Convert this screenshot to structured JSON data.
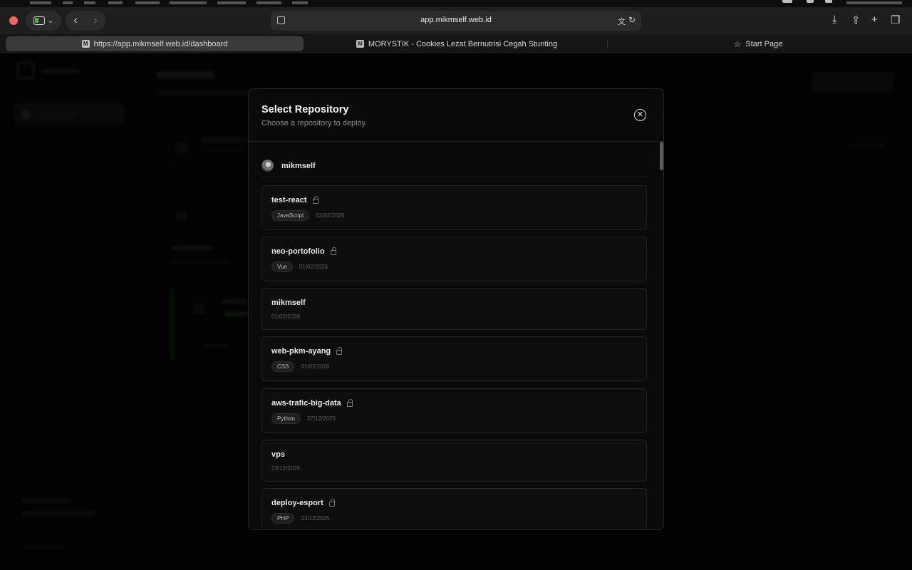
{
  "browser": {
    "address": "app.mikmself.web.id",
    "tabs": [
      {
        "title": "https://app.mikmself.web.id/dashboard",
        "favicon": "M",
        "active": true
      },
      {
        "title": "MORYSTIK - Cookies Lezat Bernutrisi Cegah Stunting",
        "favicon": "M",
        "active": false
      },
      {
        "title": "Start Page",
        "favicon": "star-icon",
        "active": false
      }
    ]
  },
  "modal": {
    "title": "Select Repository",
    "subtitle": "Choose a repository to deploy",
    "close_icon": "close-circle-icon",
    "owner": {
      "name": "mikmself"
    },
    "repositories": [
      {
        "name": "test-react",
        "private": true,
        "language": "JavaScript",
        "updated": "02/02/2026"
      },
      {
        "name": "neo-portofolio",
        "private": true,
        "language": "Vue",
        "updated": "01/02/2026"
      },
      {
        "name": "mikmself",
        "private": false,
        "language": "",
        "updated": "01/02/2026"
      },
      {
        "name": "web-pkm-ayang",
        "private": true,
        "language": "CSS",
        "updated": "01/02/2026"
      },
      {
        "name": "aws-trafic-big-data",
        "private": true,
        "language": "Python",
        "updated": "27/12/2025"
      },
      {
        "name": "vps",
        "private": false,
        "language": "",
        "updated": "23/12/2025"
      },
      {
        "name": "deploy-esport",
        "private": true,
        "language": "PHP",
        "updated": "23/12/2025"
      }
    ]
  },
  "colors": {
    "background": "#000000",
    "modal_bg": "#0a0a0a",
    "card_bg": "#0e0e0e",
    "accent_green": "#3fb950",
    "close_red": "#ec6a5e"
  }
}
